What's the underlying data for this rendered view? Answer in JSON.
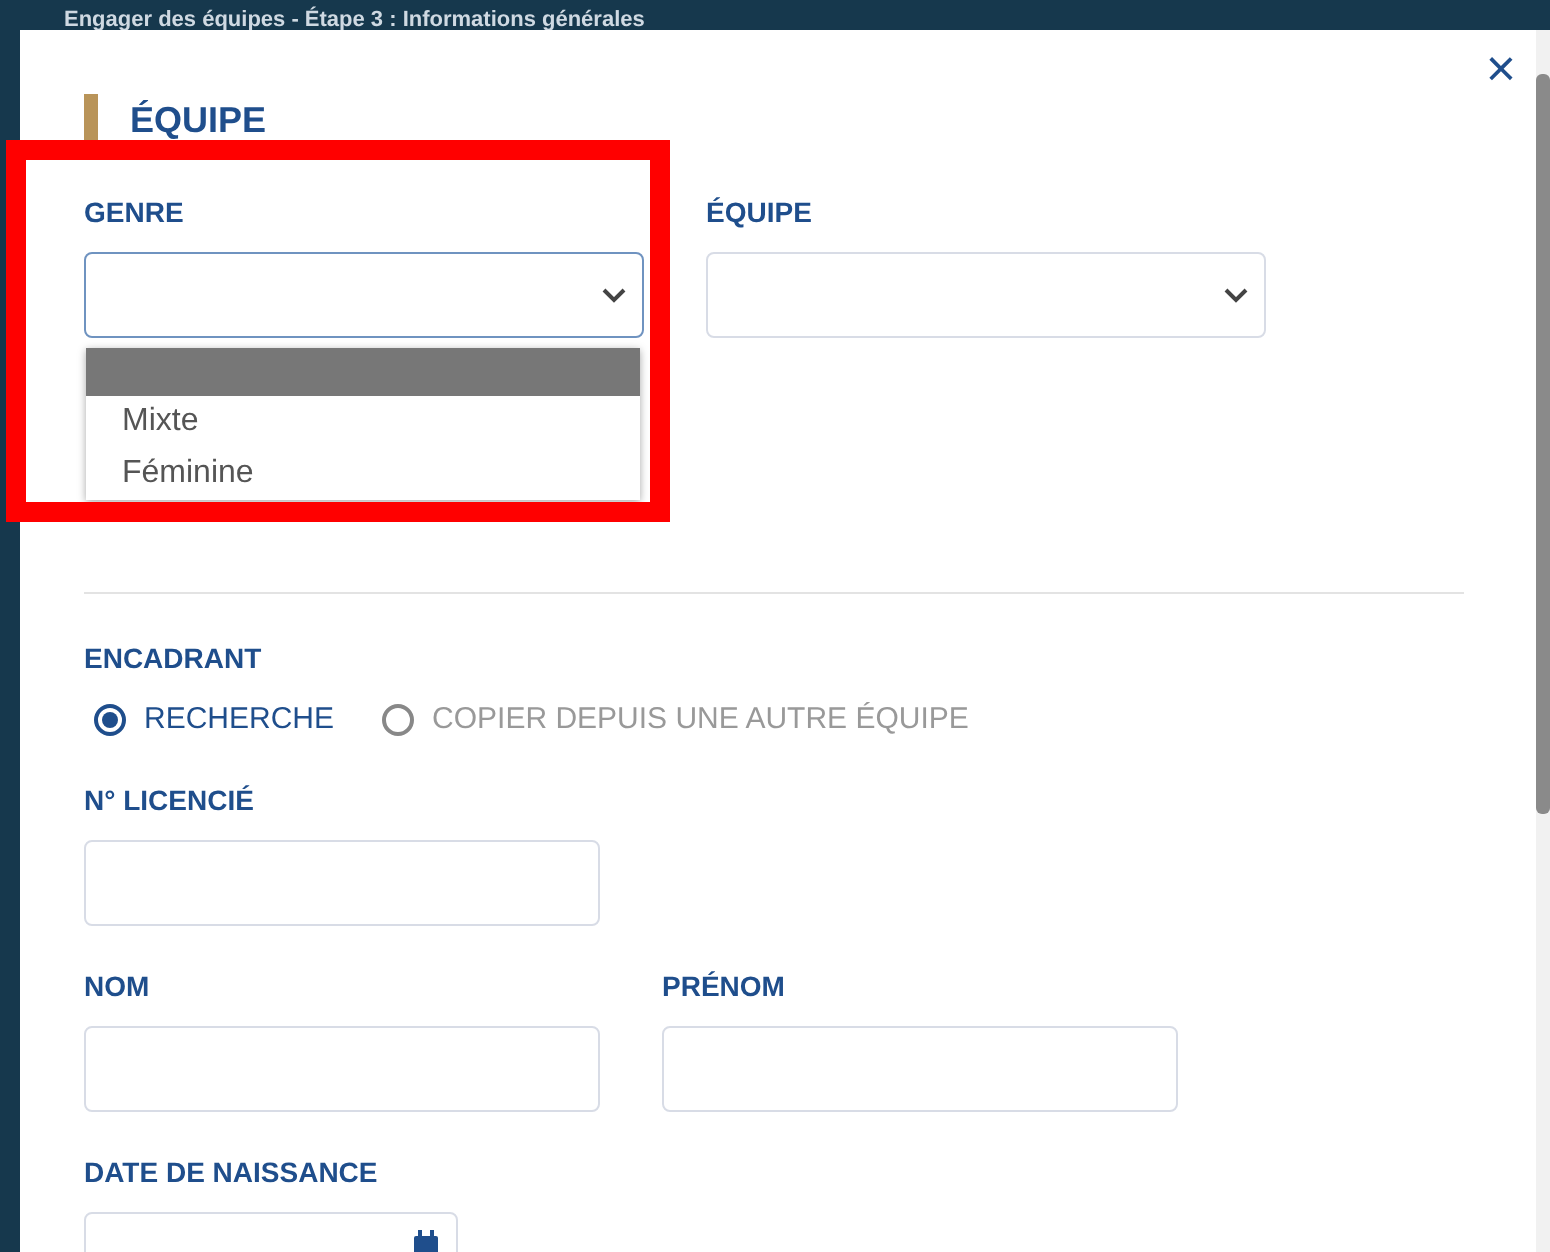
{
  "background_title": "Engager des équipes - Étape 3 : Informations générales",
  "modal": {
    "close": "×",
    "section_title": "ÉQUIPE",
    "team_fields": [
      {
        "label": "GENRE",
        "open": true,
        "options": [
          {
            "selected": true
          },
          {
            "label": "Mixte",
            "selected": false
          },
          {
            "label": "Féminine",
            "selected": false
          }
        ]
      },
      {
        "label": "ÉQUIPE",
        "open": false
      }
    ],
    "encadrant": {
      "label": "ENCADRANT",
      "choices": [
        {
          "label": "RECHERCHE",
          "selected": true
        },
        {
          "label": "COPIER DEPUIS UNE AUTRE ÉQUIPE",
          "selected": false
        }
      ]
    },
    "licence": {
      "label": "N° LICENCIÉ"
    },
    "name_fields": [
      {
        "label": "NOM"
      },
      {
        "label": "PRÉNOM"
      }
    ],
    "birth_date": {
      "label": "DATE DE NAISSANCE"
    }
  },
  "highlight": {
    "shown": true
  }
}
